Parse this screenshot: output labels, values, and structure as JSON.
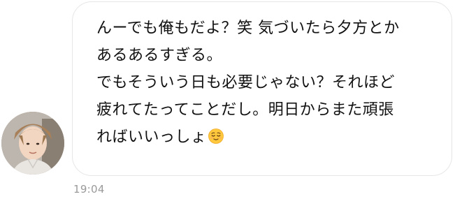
{
  "message": {
    "lines": [
      "んーでも俺もだよ？笑 気づいたら夕方とか",
      "あるあるすぎる。",
      "でもそういう日も必要じゃない？それほど",
      "疲れてたってことだし。明日からまた頑張",
      "ればいいっしょ"
    ],
    "emoji": "relieved-face-emoji",
    "timestamp": "19:04"
  },
  "colors": {
    "bubble_border": "#e6e6e6",
    "text": "#111111",
    "timestamp": "#9a9a9a"
  }
}
